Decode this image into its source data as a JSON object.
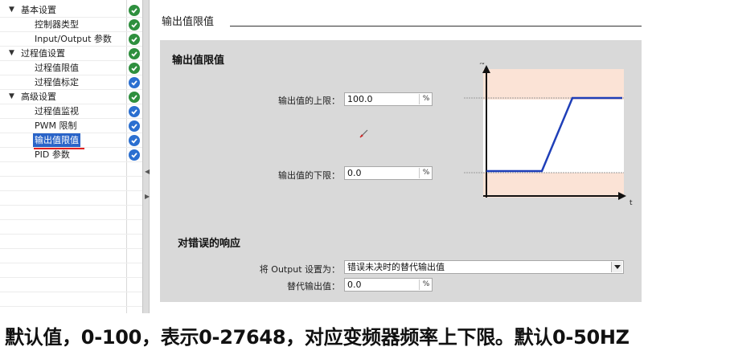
{
  "tree": {
    "items": [
      {
        "label": "基本设置",
        "expanded": true,
        "indent": 0,
        "status": "green",
        "selected": false
      },
      {
        "label": "控制器类型",
        "indent": 1,
        "status": "green",
        "selected": false
      },
      {
        "label": "Input/Output 参数",
        "indent": 1,
        "status": "green",
        "selected": false
      },
      {
        "label": "过程值设置",
        "expanded": true,
        "indent": 0,
        "status": "green",
        "selected": false
      },
      {
        "label": "过程值限值",
        "indent": 1,
        "status": "green",
        "selected": false
      },
      {
        "label": "过程值标定",
        "indent": 1,
        "status": "blue",
        "selected": false
      },
      {
        "label": "高级设置",
        "expanded": true,
        "indent": 0,
        "status": "green",
        "selected": false
      },
      {
        "label": "过程值监视",
        "indent": 1,
        "status": "blue",
        "selected": false
      },
      {
        "label": "PWM 限制",
        "indent": 1,
        "status": "blue",
        "selected": false
      },
      {
        "label": "输出值限值",
        "indent": 1,
        "status": "blue",
        "selected": true
      },
      {
        "label": "PID 参数",
        "indent": 1,
        "status": "blue",
        "selected": false
      }
    ]
  },
  "header": {
    "section_title": "输出值限值"
  },
  "panel": {
    "heading": "输出值限值",
    "upper_label": "输出值的上限：",
    "upper_value": "100.0",
    "upper_unit": "%",
    "lower_label": "输出值的下限：",
    "lower_value": "0.0",
    "lower_unit": "%",
    "diagram": {
      "y_axis_label": "%",
      "x_axis_label": "t"
    }
  },
  "response": {
    "heading": "对错误的响应",
    "output_label": "将 Output 设置为：",
    "output_value": "错误未决时的替代输出值",
    "substitute_label": "替代输出值：",
    "substitute_value": "0.0",
    "substitute_unit": "%"
  },
  "caption": "默认值，0-100，表示0-27648，对应变频器频率上下限。默认0-50HZ",
  "colors": {
    "status_green": "#2e8f3e",
    "status_blue": "#2b6fd0",
    "selection": "#2a64c8",
    "diagram_band": "#fbe3d6",
    "diagram_line": "#1f3fb8",
    "annotation_red": "#e02020"
  }
}
